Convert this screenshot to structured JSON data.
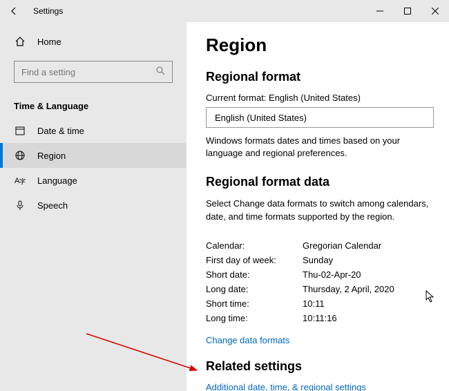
{
  "titlebar": {
    "title": "Settings"
  },
  "sidebar": {
    "home": "Home",
    "search_placeholder": "Find a setting",
    "category": "Time & Language",
    "items": [
      {
        "label": "Date & time"
      },
      {
        "label": "Region"
      },
      {
        "label": "Language"
      },
      {
        "label": "Speech"
      }
    ]
  },
  "content": {
    "heading": "Region",
    "regional_format": {
      "title": "Regional format",
      "current_label": "Current format: English (United States)",
      "dropdown_value": "English (United States)",
      "description": "Windows formats dates and times based on your language and regional preferences."
    },
    "format_data": {
      "title": "Regional format data",
      "description": "Select Change data formats to switch among calendars, date, and time formats supported by the region.",
      "rows": [
        {
          "key": "Calendar:",
          "value": "Gregorian Calendar"
        },
        {
          "key": "First day of week:",
          "value": "Sunday"
        },
        {
          "key": "Short date:",
          "value": "Thu-02-Apr-20"
        },
        {
          "key": "Long date:",
          "value": "Thursday, 2 April, 2020"
        },
        {
          "key": "Short time:",
          "value": "10:11"
        },
        {
          "key": "Long time:",
          "value": "10:11:16"
        }
      ],
      "change_link": "Change data formats"
    },
    "related": {
      "title": "Related settings",
      "link": "Additional date, time, & regional settings"
    }
  }
}
